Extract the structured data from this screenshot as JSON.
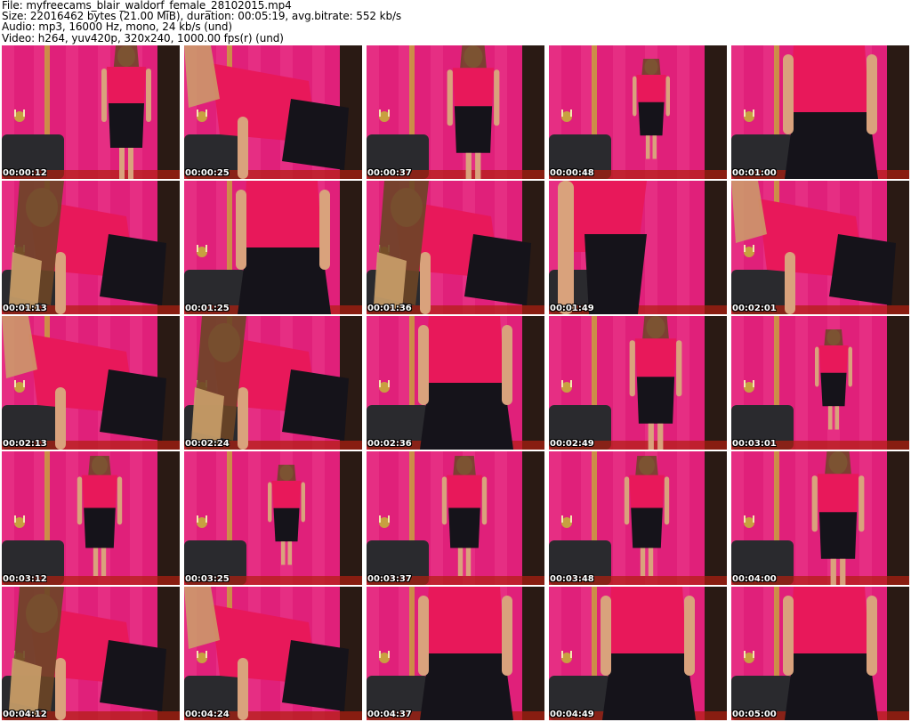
{
  "header": {
    "file_line": "File: myfreecams_blair_waldorf_female_28102015.mp4",
    "size_line": "Size: 22016462 bytes (21.00 MiB), duration: 00:05:19, avg.bitrate: 552 kb/s",
    "audio_line": "Audio: mp3, 16000 Hz, mono, 24 kb/s (und)",
    "video_line": "Video: h264, yuv420p, 320x240, 1000.00 fps(r) (und)"
  },
  "colors": {
    "wall_pink": "#e0207a",
    "wall_light": "#f04a95",
    "top_red": "#e8185a",
    "skirt_black": "#15131a",
    "chair_dark": "#2a2a2e",
    "skin": "#d9a27c",
    "hair": "#6b4526",
    "hair_blonde": "#caa06a",
    "frame_gold": "#c8a040",
    "door_dark": "#2a1a14",
    "floor_red": "#b02010"
  },
  "thumbnails": [
    {
      "time": "00:00:12",
      "variant": "standing-back"
    },
    {
      "time": "00:00:25",
      "variant": "bending"
    },
    {
      "time": "00:00:37",
      "variant": "standing-side"
    },
    {
      "time": "00:00:48",
      "variant": "standing-far"
    },
    {
      "time": "00:01:00",
      "variant": "closeup-front"
    },
    {
      "time": "00:01:13",
      "variant": "bending-face"
    },
    {
      "time": "00:01:25",
      "variant": "closeup-front"
    },
    {
      "time": "00:01:36",
      "variant": "bending-face"
    },
    {
      "time": "00:01:49",
      "variant": "arm-side"
    },
    {
      "time": "00:02:01",
      "variant": "bending"
    },
    {
      "time": "00:02:13",
      "variant": "bending"
    },
    {
      "time": "00:02:24",
      "variant": "bending-face"
    },
    {
      "time": "00:02:36",
      "variant": "closeup-front"
    },
    {
      "time": "00:02:49",
      "variant": "standing-side"
    },
    {
      "time": "00:03:01",
      "variant": "standing-far"
    },
    {
      "time": "00:03:12",
      "variant": "standing-front"
    },
    {
      "time": "00:03:25",
      "variant": "standing-far"
    },
    {
      "time": "00:03:37",
      "variant": "standing-front"
    },
    {
      "time": "00:03:48",
      "variant": "standing-front"
    },
    {
      "time": "00:04:00",
      "variant": "standing-side"
    },
    {
      "time": "00:04:12",
      "variant": "bending-face"
    },
    {
      "time": "00:04:24",
      "variant": "bending"
    },
    {
      "time": "00:04:37",
      "variant": "closeup-front"
    },
    {
      "time": "00:04:49",
      "variant": "closeup-front"
    },
    {
      "time": "00:05:00",
      "variant": "closeup-front"
    }
  ]
}
